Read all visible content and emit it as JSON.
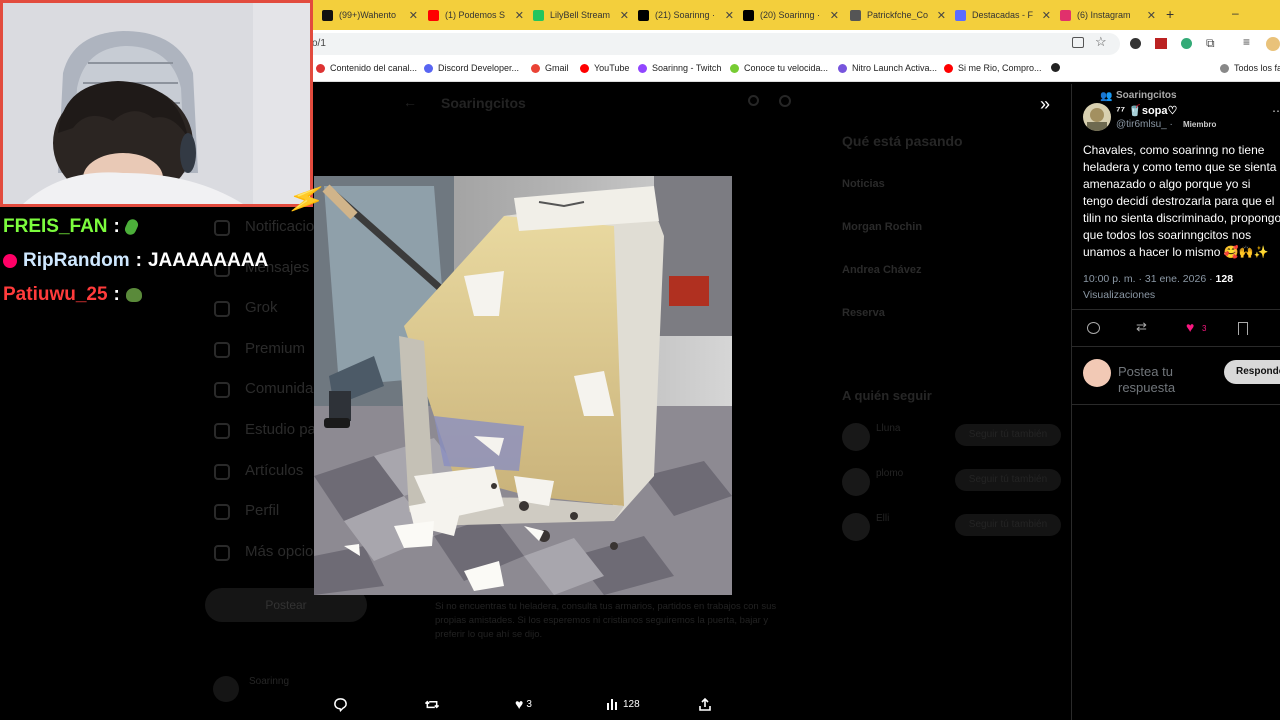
{
  "browser": {
    "tabs": [
      {
        "label": "(99+)Wahento",
        "color": "#111111"
      },
      {
        "label": "(1) Podemos S",
        "color": "#ff0000"
      },
      {
        "label": "LilyBell Stream",
        "color": "#22c55e"
      },
      {
        "label": "(21) Soarinng ·",
        "color": "#000000"
      },
      {
        "label": "(20) Soarinng ·",
        "color": "#000000"
      },
      {
        "label": "Patrickfche_Co",
        "color": "#555555"
      },
      {
        "label": "Destacadas - F",
        "color": "#5b6cff"
      },
      {
        "label": "(6) Instagram",
        "color": "#e1306c"
      }
    ],
    "new_tab": "+",
    "address": "o/1",
    "bookmarks": [
      {
        "label": "Contenido del canal...",
        "color": "#d33"
      },
      {
        "label": "Discord Developer...",
        "color": "#5865f2"
      },
      {
        "label": "Gmail",
        "color": "#ea4335"
      },
      {
        "label": "YouTube",
        "color": "#ff0000"
      },
      {
        "label": "Soarinng - Twitch",
        "color": "#9146ff"
      },
      {
        "label": "Conoce tu velocida...",
        "color": "#77cc33"
      },
      {
        "label": "Nitro Launch Activa...",
        "color": "#7755dd"
      },
      {
        "label": "Si me Rio, Compro...",
        "color": "#ff0000"
      },
      {
        "label": "",
        "color": "#222222"
      },
      {
        "label": "Todos los fa",
        "color": "#888888"
      }
    ]
  },
  "background": {
    "header_title": "Soaringcitos",
    "nav": [
      "Notificaciones",
      "Mensajes",
      "Grok",
      "Premium",
      "Comunidades",
      "Estudio para creadores",
      "Artículos",
      "Perfil",
      "Más opciones"
    ],
    "post_button": "Postear",
    "trend_title": "Qué está pasando",
    "trends": [
      "Noticias",
      "Morgan Rochin",
      "Andrea Chávez",
      "Reserva"
    ],
    "who_to_follow": "A quién seguir",
    "follow_names": [
      "Lluna",
      "plomo",
      "Elli"
    ],
    "follow_button": "Seguir tú también",
    "profile_name": "Soarinng",
    "bg_text": "Si no encuentras tu heladera, consulta tus armarios, partidos en trabajos con sus propias amistades. Si los esperemos ni cristianos seguiremos la puerta, bajar y preferir lo que ahí se dijo."
  },
  "chat": [
    {
      "user": "FREIS_FAN",
      "user_color": "#7cfc3d",
      "message": "",
      "emote": "pickle-emote"
    },
    {
      "user": "RipRandom",
      "user_color": "#cfe8ff",
      "message": "JAAAAAAAA",
      "emote": "badge-emote"
    },
    {
      "user": "Patiuwu_25",
      "user_color": "#ff3b3b",
      "message": "",
      "emote": "pepe-emote"
    }
  ],
  "chat_separator": ":",
  "tweet": {
    "community": "Soaringcitos",
    "display_name": "⁷⁷ 🥤sopa♡",
    "handle": "@tir6mlsu_ ·",
    "badge": "Miembro",
    "text": "Chavales, como soarinng no tiene heladera y como temo que se sienta amenazado o algo porque yo si tengo decidí destrozarla para que el tilin no sienta discriminado, propongo que todos los soarinngcitos nos unamos a hacer lo mismo 🥰🙌✨",
    "time": "10:00 p. m. · 31 ene. 2026 ·",
    "views_count": "128",
    "views_label": "Visualizaciones",
    "likes": "3",
    "reply_placeholder": "Postea tu respuesta",
    "reply_button": "Responder"
  },
  "viewer_actions": {
    "likes": "3",
    "views": "128"
  },
  "colors": {
    "tab_bar": "#f3cf3c",
    "webcam_border": "#e24b3e",
    "like_pink": "#f91880"
  }
}
